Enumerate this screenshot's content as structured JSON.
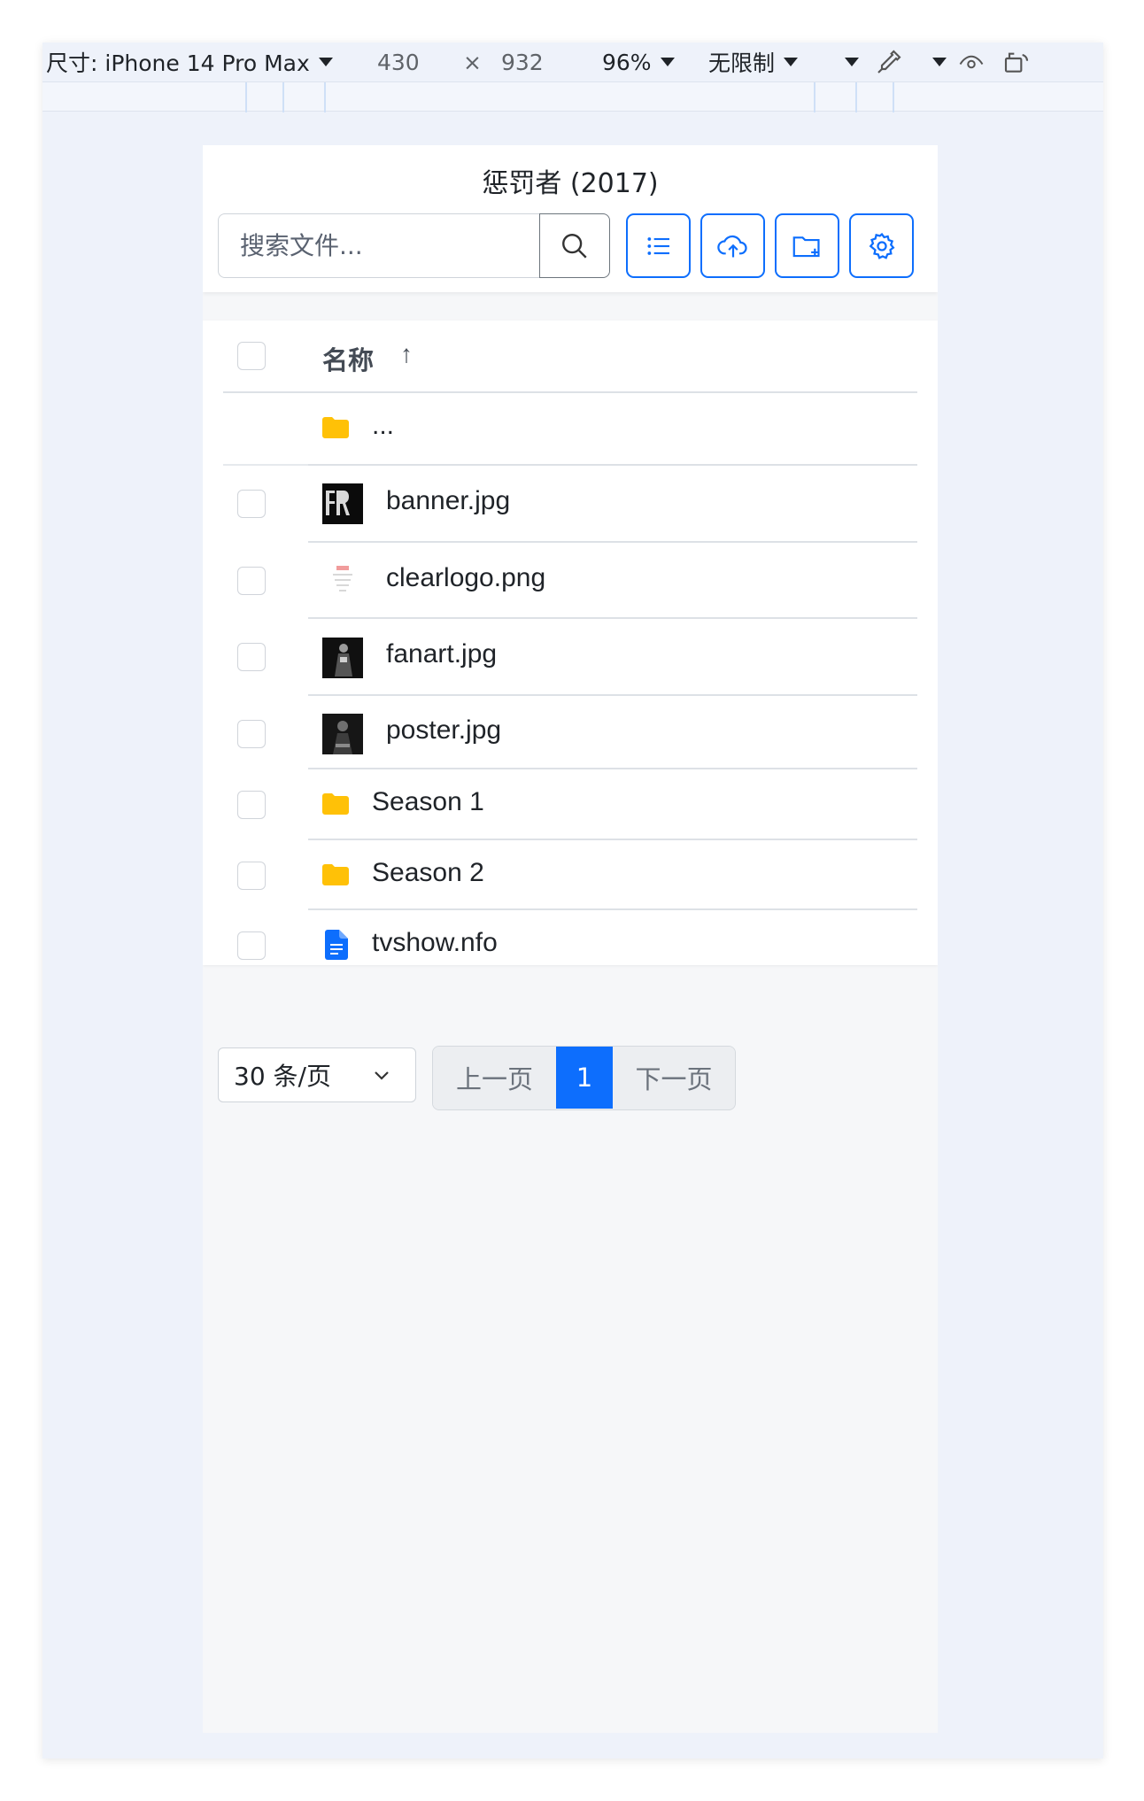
{
  "devtools": {
    "device_label": "尺寸: iPhone 14 Pro Max",
    "width": "430",
    "times": "×",
    "height": "932",
    "zoom": "96%",
    "throttle": "无限制"
  },
  "app": {
    "title": "惩罚者 (2017)",
    "search_placeholder": "搜索文件...",
    "toolbar_icons": [
      "list-icon",
      "cloud-upload-icon",
      "folder-plus-icon",
      "gear-icon"
    ],
    "accent": "#0d6efd",
    "folder_color": "#ffc107"
  },
  "table": {
    "header": {
      "name": "名称",
      "sort": "↑"
    },
    "parent_label": "...",
    "rows": [
      {
        "name": "banner.jpg",
        "type": "image"
      },
      {
        "name": "clearlogo.png",
        "type": "image"
      },
      {
        "name": "fanart.jpg",
        "type": "image"
      },
      {
        "name": "poster.jpg",
        "type": "image"
      },
      {
        "name": "Season 1",
        "type": "folder"
      },
      {
        "name": "Season 2",
        "type": "folder"
      },
      {
        "name": "tvshow.nfo",
        "type": "document"
      }
    ]
  },
  "pagination": {
    "page_size": "30 条/页",
    "prev": "上一页",
    "current": "1",
    "next": "下一页"
  }
}
